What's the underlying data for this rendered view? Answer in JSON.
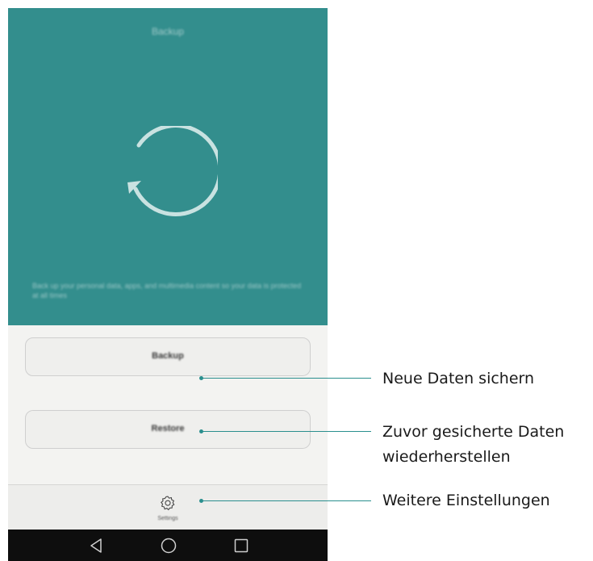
{
  "hero": {
    "title": "Backup",
    "description": "Back up your personal data, apps, and multimedia content so your data is protected at all times"
  },
  "actions": {
    "backup_label": "Backup",
    "restore_label": "Restore"
  },
  "settings": {
    "label": "Settings",
    "icon": "gear-icon"
  },
  "navbar": {
    "icons": [
      "back-triangle-icon",
      "home-circle-icon",
      "recents-square-icon"
    ]
  },
  "callouts": {
    "backup": "Neue Daten sichern",
    "restore_line1": "Zuvor gesicherte Daten",
    "restore_line2": "wiederherstellen",
    "settings": "Weitere Einstellungen"
  },
  "colors": {
    "accent": "#338e8d",
    "callout": "#2a8f8e",
    "navbar": "#0e0e0e"
  }
}
